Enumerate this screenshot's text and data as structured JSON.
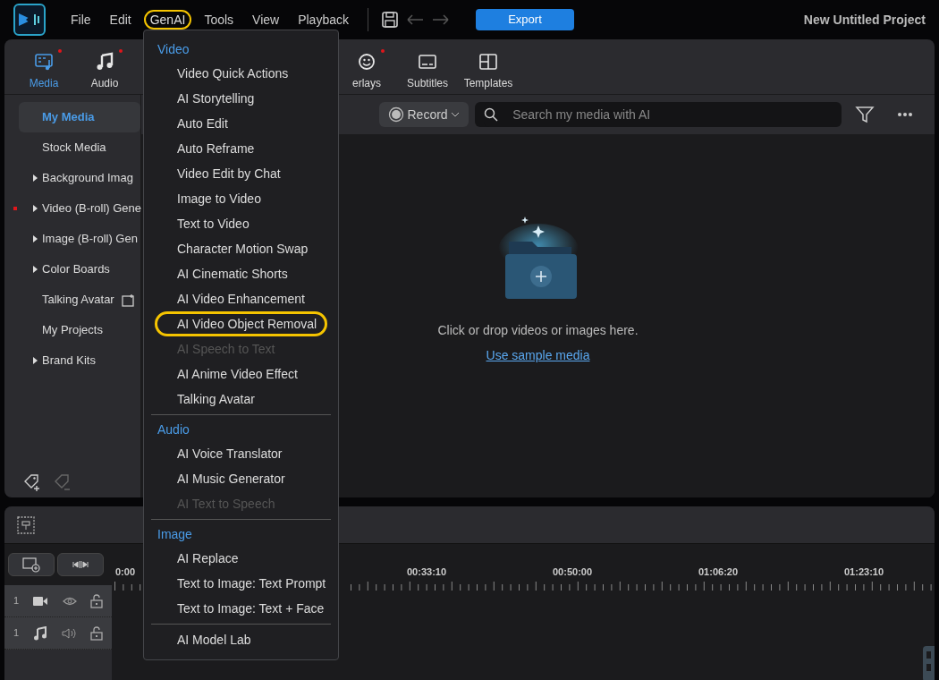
{
  "app": {
    "title": "New Untitled Project",
    "export": "Export"
  },
  "menubar": [
    {
      "label": "File",
      "open": false
    },
    {
      "label": "Edit",
      "open": false
    },
    {
      "label": "GenAI",
      "open": true
    },
    {
      "label": "Tools",
      "open": false
    },
    {
      "label": "View",
      "open": false
    },
    {
      "label": "Playback",
      "open": false
    }
  ],
  "tabs": [
    {
      "kind": "media",
      "label": "Media",
      "selected": true,
      "new": true
    },
    {
      "kind": "audio",
      "label": "Audio",
      "selected": false,
      "new": true
    },
    {
      "kind": "overlays",
      "label": "erlays",
      "selected": false,
      "new": true
    },
    {
      "kind": "subtitles",
      "label": "Subtitles",
      "selected": false,
      "new": false
    },
    {
      "kind": "templates",
      "label": "Templates",
      "selected": false,
      "new": false
    }
  ],
  "sidebar": {
    "items": [
      {
        "label": "My Media",
        "selected": true,
        "expandable": false,
        "new": false,
        "ai": false
      },
      {
        "label": "Stock Media",
        "selected": false,
        "expandable": false,
        "new": false,
        "ai": false
      },
      {
        "label": "Background Imag",
        "selected": false,
        "expandable": true,
        "new": false,
        "ai": false
      },
      {
        "label": "Video (B-roll) Gene",
        "selected": false,
        "expandable": true,
        "new": true,
        "ai": false
      },
      {
        "label": "Image (B-roll) Gen",
        "selected": false,
        "expandable": true,
        "new": false,
        "ai": false
      },
      {
        "label": "Color Boards",
        "selected": false,
        "expandable": true,
        "new": false,
        "ai": false
      },
      {
        "label": "Talking Avatar",
        "selected": false,
        "expandable": false,
        "new": false,
        "ai": true
      },
      {
        "label": "My Projects",
        "selected": false,
        "expandable": false,
        "new": false,
        "ai": false
      },
      {
        "label": "Brand Kits",
        "selected": false,
        "expandable": true,
        "new": false,
        "ai": false
      }
    ]
  },
  "media_toolbar": {
    "record": "Record",
    "search_placeholder": "Search my media with AI"
  },
  "media_area": {
    "hint": "Click or drop videos or images here.",
    "link": "Use sample media"
  },
  "timeline": {
    "ruler": [
      "0:00",
      "00:33:10",
      "00:50:00",
      "01:06:20",
      "01:23:10"
    ],
    "tracks": [
      {
        "kind": "video",
        "number": "1"
      },
      {
        "kind": "audio",
        "number": "1"
      }
    ]
  },
  "genai_menu": {
    "sections": [
      {
        "header": "Video",
        "items": [
          {
            "label": "Video Quick Actions",
            "disabled": false,
            "highlighted": false
          },
          {
            "label": "AI Storytelling",
            "disabled": false,
            "highlighted": false
          },
          {
            "label": "Auto Edit",
            "disabled": false,
            "highlighted": false
          },
          {
            "label": "Auto Reframe",
            "disabled": false,
            "highlighted": false
          },
          {
            "label": "Video Edit by Chat",
            "disabled": false,
            "highlighted": false
          },
          {
            "label": "Image to Video",
            "disabled": false,
            "highlighted": false
          },
          {
            "label": "Text to Video",
            "disabled": false,
            "highlighted": false
          },
          {
            "label": "Character Motion Swap",
            "disabled": false,
            "highlighted": false
          },
          {
            "label": "AI Cinematic Shorts",
            "disabled": false,
            "highlighted": false
          },
          {
            "label": "AI Video Enhancement",
            "disabled": false,
            "highlighted": false
          },
          {
            "label": "AI Video Object Removal",
            "disabled": false,
            "highlighted": true
          },
          {
            "label": "AI Speech to Text",
            "disabled": true,
            "highlighted": false
          },
          {
            "label": "AI Anime Video Effect",
            "disabled": false,
            "highlighted": false
          },
          {
            "label": "Talking Avatar",
            "disabled": false,
            "highlighted": false
          }
        ]
      },
      {
        "header": "Audio",
        "items": [
          {
            "label": "AI Voice Translator",
            "disabled": false,
            "highlighted": false
          },
          {
            "label": "AI Music Generator",
            "disabled": false,
            "highlighted": false
          },
          {
            "label": "AI Text to Speech",
            "disabled": true,
            "highlighted": false
          }
        ]
      },
      {
        "header": "Image",
        "items": [
          {
            "label": "AI Replace",
            "disabled": false,
            "highlighted": false
          },
          {
            "label": "Text to Image: Text Prompt",
            "disabled": false,
            "highlighted": false
          },
          {
            "label": "Text to Image: Text + Face",
            "disabled": false,
            "highlighted": false
          }
        ]
      },
      {
        "items": [
          {
            "label": "AI Model Lab",
            "disabled": false,
            "highlighted": false
          }
        ]
      }
    ]
  }
}
